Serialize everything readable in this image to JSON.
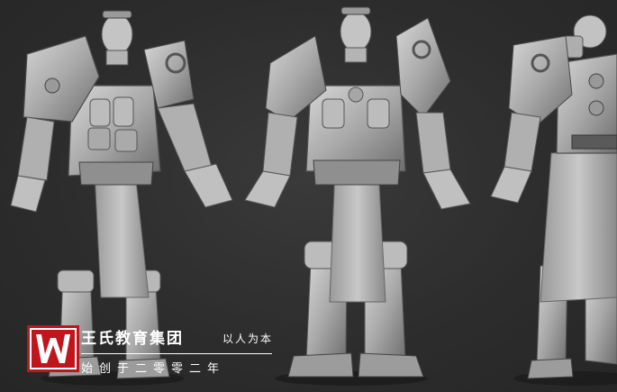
{
  "brand": {
    "name": "王氏教育集团",
    "slogan": "以人为本",
    "founded": "始创于二零零二年",
    "logo_letter": "W",
    "accent_color": "#c0151b"
  },
  "scene": {
    "background_color": "#2e2e2e",
    "model_color": "#bdbdbd",
    "views": [
      "three-quarter",
      "front",
      "back"
    ]
  }
}
